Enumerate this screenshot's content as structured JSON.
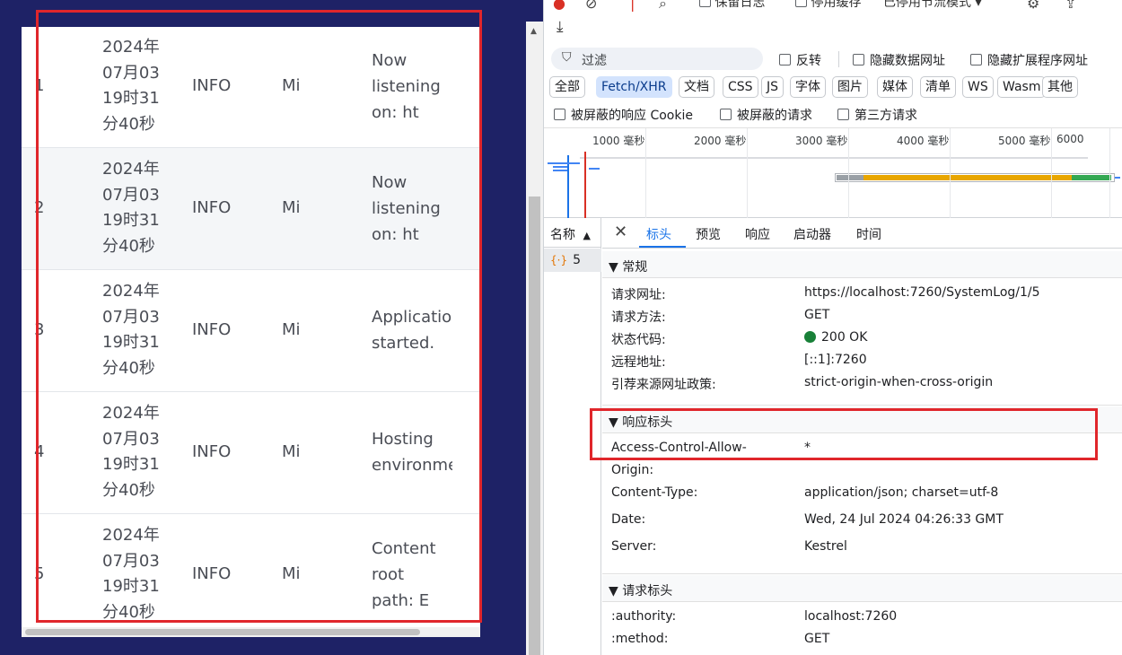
{
  "log_table": {
    "rows": [
      {
        "id": "1",
        "time": [
          "2024年",
          "07月03",
          "19时31",
          "分40秒"
        ],
        "level": "INFO",
        "logger": "Mi",
        "message": [
          "Now",
          "listening",
          "on: ht"
        ]
      },
      {
        "id": "2",
        "time": [
          "2024年",
          "07月03",
          "19时31",
          "分40秒"
        ],
        "level": "INFO",
        "logger": "Mi",
        "message": [
          "Now",
          "listening",
          "on: ht"
        ]
      },
      {
        "id": "3",
        "time": [
          "2024年",
          "07月03",
          "19时31",
          "分40秒"
        ],
        "level": "INFO",
        "logger": "Mi",
        "message": [
          "Applicatio",
          "started."
        ]
      },
      {
        "id": "4",
        "time": [
          "2024年",
          "07月03",
          "19时31",
          "分40秒"
        ],
        "level": "INFO",
        "logger": "Mi",
        "message": [
          "Hosting",
          "environme"
        ]
      },
      {
        "id": "5",
        "time": [
          "2024年",
          "07月03",
          "19时31",
          "分40秒"
        ],
        "level": "INFO",
        "logger": "Mi",
        "message": [
          "Content",
          "root",
          "path: E"
        ]
      }
    ]
  },
  "devtools": {
    "toolbar": {
      "preserve_log": "保留日志",
      "disable_cache": "停用缓存",
      "throttle": "已停用节流模式"
    },
    "filter": {
      "placeholder": "过滤",
      "invert": "反转",
      "hide_data_urls": "隐藏数据网址",
      "hide_extension_urls": "隐藏扩展程序网址"
    },
    "type_filters": [
      "全部",
      "Fetch/XHR",
      "文档",
      "CSS",
      "JS",
      "字体",
      "图片",
      "媒体",
      "清单",
      "WS",
      "Wasm",
      "其他"
    ],
    "active_type": "Fetch/XHR",
    "options": {
      "blocked_cookies": "被屏蔽的响应 Cookie",
      "blocked_requests": "被屏蔽的请求",
      "third_party": "第三方请求"
    },
    "timeline_ticks": [
      "1000 毫秒",
      "2000 毫秒",
      "3000 毫秒",
      "4000 毫秒",
      "5000 毫秒",
      "6000"
    ],
    "name_column": {
      "header": "名称",
      "sort_icon": "▲",
      "request_name": "5"
    },
    "detail_tabs": [
      "标头",
      "预览",
      "响应",
      "启动器",
      "时间"
    ],
    "active_tab": "标头",
    "general": {
      "title": "常规",
      "rows": [
        {
          "key": "请求网址:",
          "value": "https://localhost:7260/SystemLog/1/5"
        },
        {
          "key": "请求方法:",
          "value": "GET"
        },
        {
          "key": "状态代码:",
          "value": "200 OK"
        },
        {
          "key": "远程地址:",
          "value": "[::1]:7260"
        },
        {
          "key": "引荐来源网址政策:",
          "value": "strict-origin-when-cross-origin"
        }
      ]
    },
    "response_headers": {
      "title": "响应标头",
      "acao_key_line1": "Access-Control-Allow-",
      "acao_key_line2": "Origin:",
      "acao_value": "*",
      "rows": [
        {
          "key": "Content-Type:",
          "value": "application/json; charset=utf-8"
        },
        {
          "key": "Date:",
          "value": "Wed, 24 Jul 2024 04:26:33 GMT"
        },
        {
          "key": "Server:",
          "value": "Kestrel"
        }
      ]
    },
    "request_headers": {
      "title": "请求标头",
      "rows": [
        {
          "key": ":authority:",
          "value": "localhost:7260"
        },
        {
          "key": ":method:",
          "value": "GET"
        }
      ]
    }
  },
  "colors": {
    "page_bg": "#1e2266",
    "highlight": "#e0262b",
    "accent": "#1a73e8",
    "status_ok": "#188038"
  }
}
